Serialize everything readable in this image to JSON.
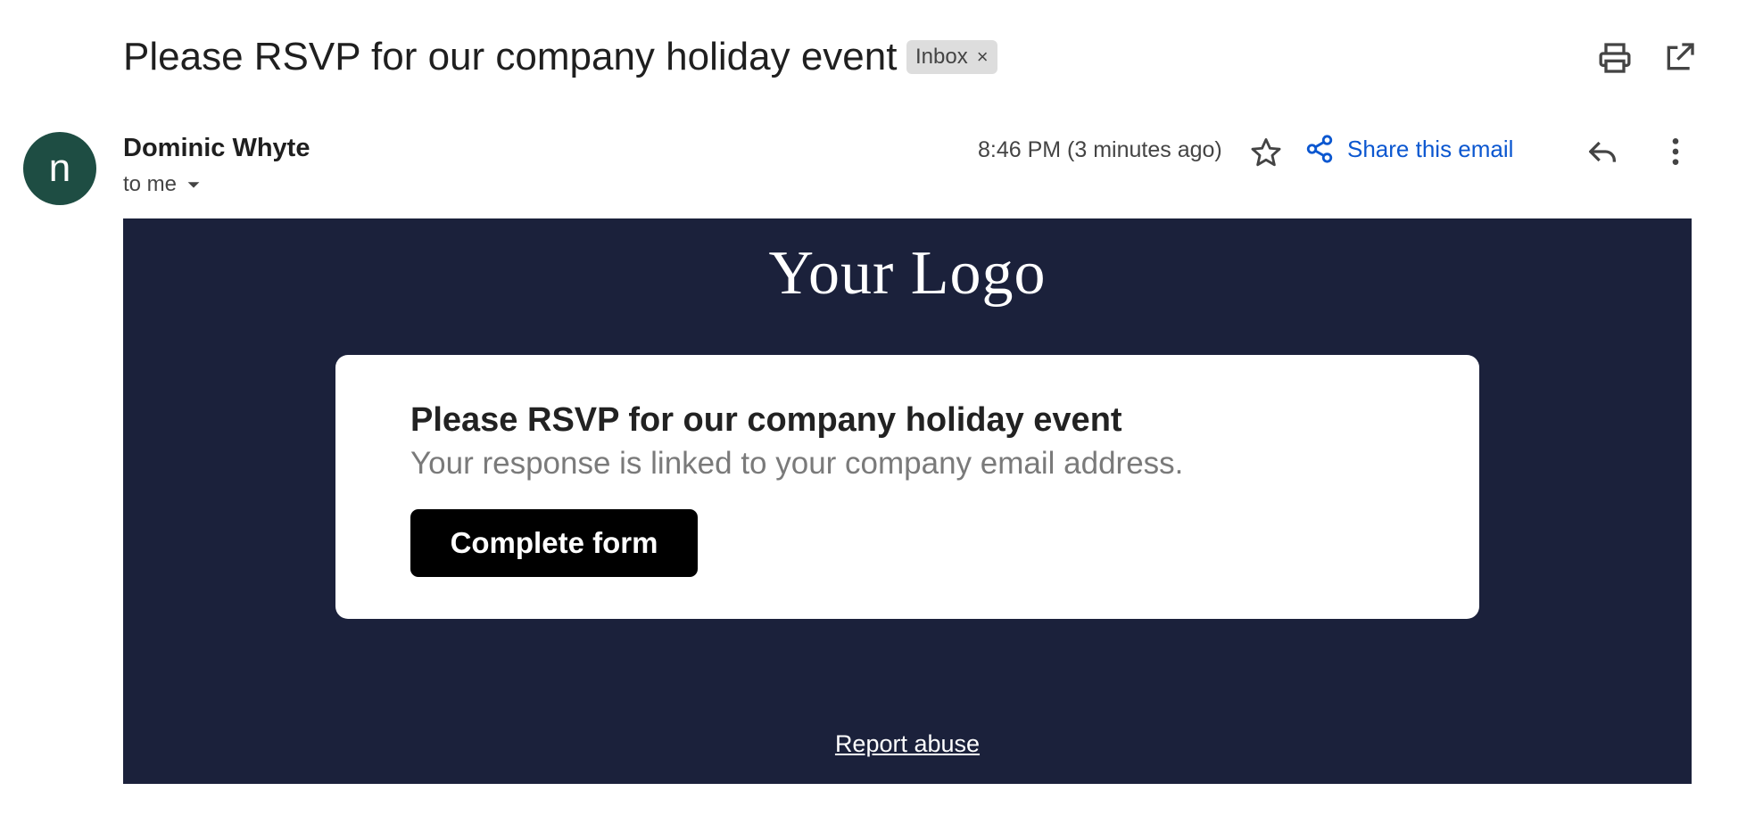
{
  "header": {
    "subject": "Please RSVP for our company holiday event",
    "label": "Inbox",
    "label_remove": "×",
    "print_icon": "printer-icon",
    "open_new_window_icon": "open-in-new-icon"
  },
  "message": {
    "avatar_letter": "n",
    "avatar_color": "#1e4d43",
    "sender": "Dominic Whyte",
    "recipients": "to me",
    "timestamp": "8:46 PM (3 minutes ago)",
    "share_label": "Share this email",
    "accent_color": "#0b57d0"
  },
  "email": {
    "background_color": "#1b213b",
    "logo_text": "Your Logo",
    "card_title": "Please RSVP for our company holiday event",
    "card_subtitle": "Your response is linked to your company email address.",
    "cta_label": "Complete form",
    "footer_link": "Report abuse"
  }
}
